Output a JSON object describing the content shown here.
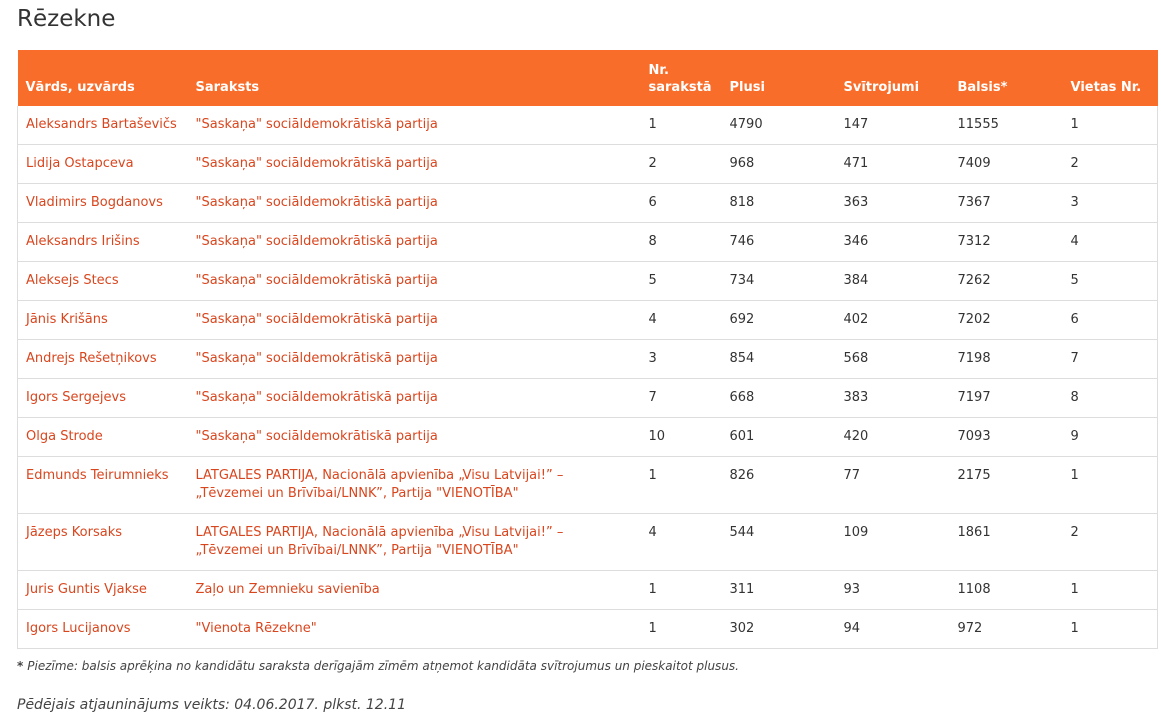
{
  "page": {
    "title": "Rēzekne",
    "note_star": "*",
    "note": "Piezīme: balsis aprēķina no kandidātu saraksta derīgajām zīmēm atņemot kandidāta svītrojumus un pieskaitot plusus.",
    "updated": "Pēdējais atjauninājums veikts: 04.06.2017. plkst. 12.11"
  },
  "colors": {
    "header_bg": "#f96d2a",
    "link": "#d9461e"
  },
  "table": {
    "headers": {
      "name": "Vārds, uzvārds",
      "list": "Saraksts",
      "list_no": "Nr. sarakstā",
      "plus": "Plusi",
      "strike": "Svītrojumi",
      "votes": "Balsis*",
      "place": "Vietas Nr."
    },
    "rows": [
      {
        "name": "Aleksandrs Bartaševičs",
        "list": "\"Saskaņa\" sociāldemokrātiskā partija",
        "list_no": "1",
        "plus": "4790",
        "strike": "147",
        "votes": "11555",
        "place": "1"
      },
      {
        "name": "Lidija Ostapceva",
        "list": "\"Saskaņa\" sociāldemokrātiskā partija",
        "list_no": "2",
        "plus": "968",
        "strike": "471",
        "votes": "7409",
        "place": "2"
      },
      {
        "name": "Vladimirs Bogdanovs",
        "list": "\"Saskaņa\" sociāldemokrātiskā partija",
        "list_no": "6",
        "plus": "818",
        "strike": "363",
        "votes": "7367",
        "place": "3"
      },
      {
        "name": "Aleksandrs Irišins",
        "list": "\"Saskaņa\" sociāldemokrātiskā partija",
        "list_no": "8",
        "plus": "746",
        "strike": "346",
        "votes": "7312",
        "place": "4"
      },
      {
        "name": "Aleksejs Stecs",
        "list": "\"Saskaņa\" sociāldemokrātiskā partija",
        "list_no": "5",
        "plus": "734",
        "strike": "384",
        "votes": "7262",
        "place": "5"
      },
      {
        "name": "Jānis Krišāns",
        "list": "\"Saskaņa\" sociāldemokrātiskā partija",
        "list_no": "4",
        "plus": "692",
        "strike": "402",
        "votes": "7202",
        "place": "6"
      },
      {
        "name": "Andrejs Rešetņikovs",
        "list": "\"Saskaņa\" sociāldemokrātiskā partija",
        "list_no": "3",
        "plus": "854",
        "strike": "568",
        "votes": "7198",
        "place": "7"
      },
      {
        "name": "Igors Sergejevs",
        "list": "\"Saskaņa\" sociāldemokrātiskā partija",
        "list_no": "7",
        "plus": "668",
        "strike": "383",
        "votes": "7197",
        "place": "8"
      },
      {
        "name": "Olga Strode",
        "list": "\"Saskaņa\" sociāldemokrātiskā partija",
        "list_no": "10",
        "plus": "601",
        "strike": "420",
        "votes": "7093",
        "place": "9"
      },
      {
        "name": "Edmunds Teirumnieks",
        "list": "LATGALES PARTIJA, Nacionālā apvienība „Visu Latvijai!” – „Tēvzemei un Brīvībai/LNNK”, Partija \"VIENOTĪBA\"",
        "list_no": "1",
        "plus": "826",
        "strike": "77",
        "votes": "2175",
        "place": "1"
      },
      {
        "name": "Jāzeps Korsaks",
        "list": "LATGALES PARTIJA, Nacionālā apvienība „Visu Latvijai!” – „Tēvzemei un Brīvībai/LNNK”, Partija \"VIENOTĪBA\"",
        "list_no": "4",
        "plus": "544",
        "strike": "109",
        "votes": "1861",
        "place": "2"
      },
      {
        "name": "Juris Guntis Vjakse",
        "list": "Zaļo un Zemnieku savienība",
        "list_no": "1",
        "plus": "311",
        "strike": "93",
        "votes": "1108",
        "place": "1"
      },
      {
        "name": "Igors Lucijanovs",
        "list": "\"Vienota Rēzekne\"",
        "list_no": "1",
        "plus": "302",
        "strike": "94",
        "votes": "972",
        "place": "1"
      }
    ]
  }
}
